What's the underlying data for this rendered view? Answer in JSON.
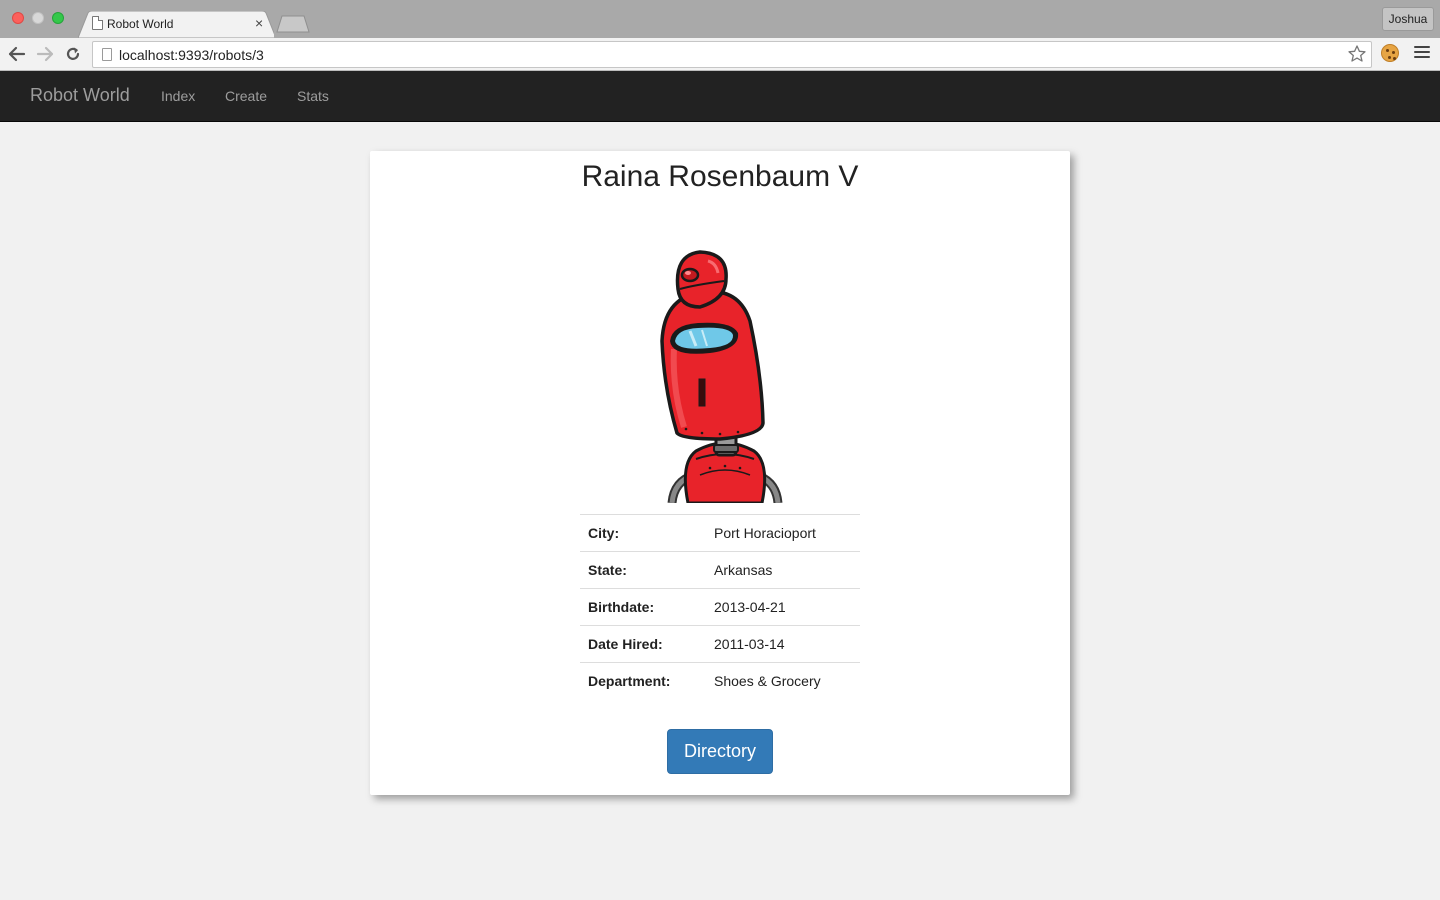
{
  "browser": {
    "tab_title": "Robot World",
    "tab_close": "×",
    "url": "localhost:9393/robots/3",
    "profile_name": "Joshua"
  },
  "navbar": {
    "brand": "Robot World",
    "links": [
      {
        "label": "Index"
      },
      {
        "label": "Create"
      },
      {
        "label": "Stats"
      }
    ],
    "bg_color": "#222222",
    "link_color": "#9d9d9d"
  },
  "robot": {
    "name": "Raina Rosenbaum V",
    "details": [
      {
        "label": "City:",
        "value": "Port Horacioport"
      },
      {
        "label": "State:",
        "value": "Arkansas"
      },
      {
        "label": "Birthdate:",
        "value": "2013-04-21"
      },
      {
        "label": "Date Hired:",
        "value": "2011-03-14"
      },
      {
        "label": "Department:",
        "value": "Shoes & Grocery"
      }
    ],
    "avatar_color": "#e8232a"
  },
  "actions": {
    "directory_label": "Directory",
    "primary_color": "#337ab7"
  }
}
